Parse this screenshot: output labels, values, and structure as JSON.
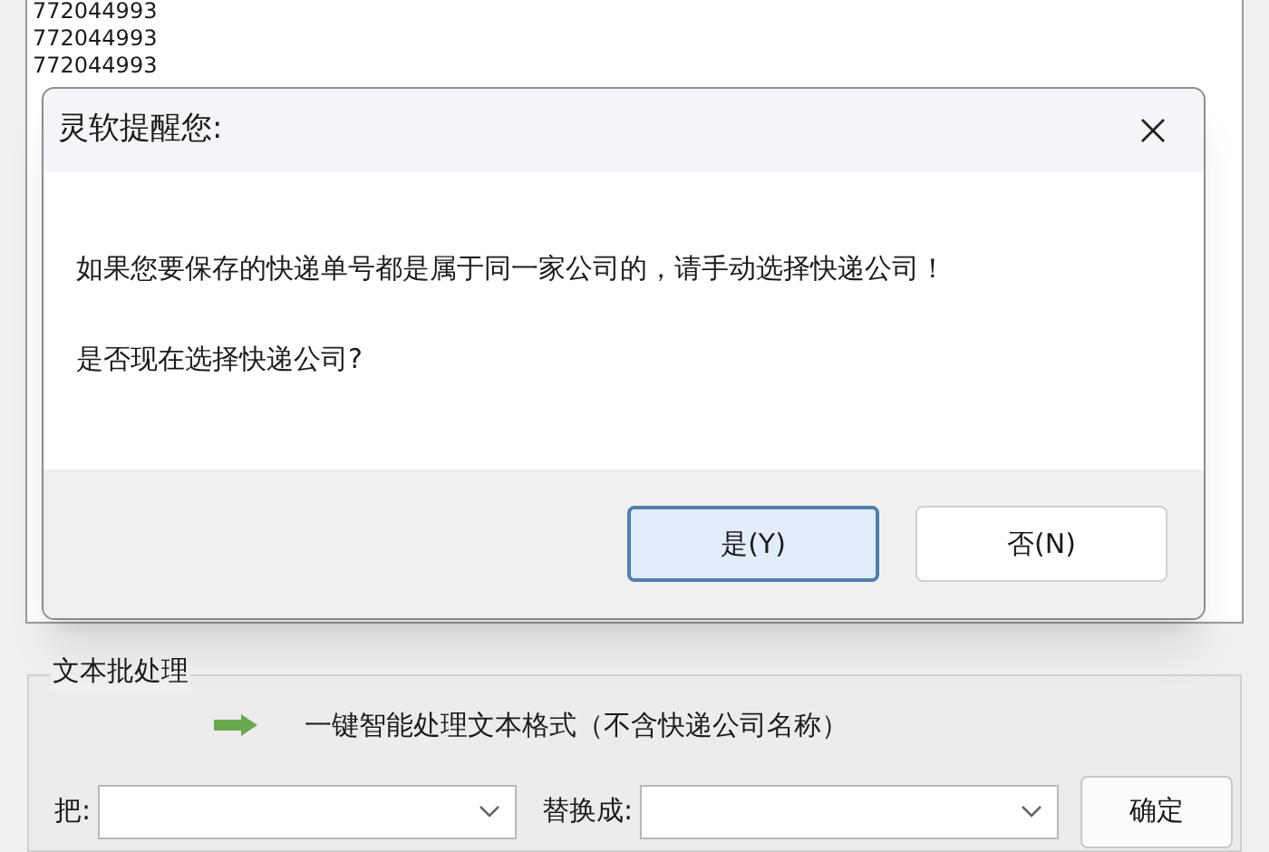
{
  "list": {
    "rows": [
      "772044993",
      "772044993",
      "772044993"
    ]
  },
  "dialog": {
    "title": "灵软提醒您:",
    "messages": [
      "如果您要保存的快递单号都是属于同一家公司的，请手动选择快递公司！",
      "是否现在选择快递公司?"
    ],
    "buttons": [
      {
        "label": "是(Y)",
        "selected": true
      },
      {
        "label": "否(N)",
        "selected": false
      }
    ]
  },
  "group": {
    "title": "文本批处理",
    "action": "一键智能处理文本格式（不含快递公司名称）",
    "from_label": "把:",
    "to_label": "替换成:",
    "confirm": "确定"
  }
}
